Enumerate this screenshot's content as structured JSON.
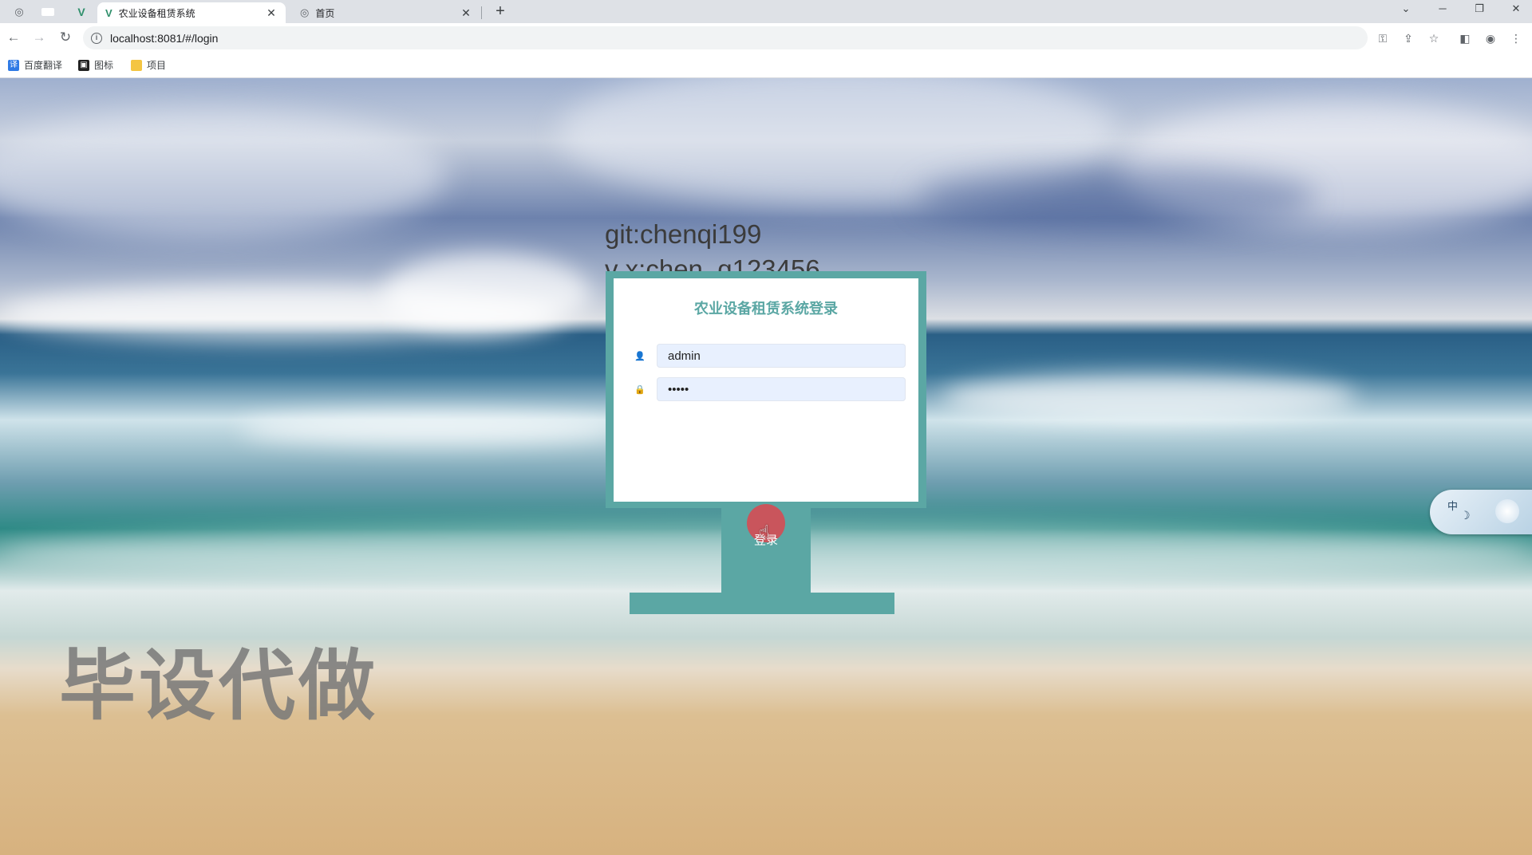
{
  "browser": {
    "tabs": [
      {
        "title": "农业设备租赁系统",
        "active": true,
        "icon": "vue-logo-icon"
      },
      {
        "title": "首页",
        "active": false,
        "icon": "globe-icon"
      }
    ],
    "url": "localhost:8081/#/login",
    "bookmarks": [
      {
        "label": "百度翻译",
        "icon": "translate-icon"
      },
      {
        "label": "图标",
        "icon": "image-icon"
      },
      {
        "label": "项目",
        "icon": "folder-icon"
      }
    ]
  },
  "page": {
    "credit_line1": "git:chenqi199",
    "credit_line2": "v x:chen_q123456",
    "login": {
      "title": "农业设备租赁系统登录",
      "username_value": "admin",
      "password_value": "•••••",
      "button_label": "登录",
      "accent_color": "#5ba7a4",
      "button_color": "#c9555c"
    },
    "watermark": "毕设代做",
    "ime": {
      "lang": "中"
    }
  }
}
